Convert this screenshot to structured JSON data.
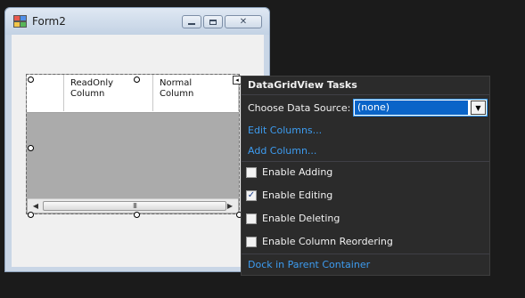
{
  "form": {
    "title": "Form2"
  },
  "grid": {
    "columns": [
      {
        "line1": "ReadOnly",
        "line2": "Column"
      },
      {
        "line1": "Normal",
        "line2": "Column"
      }
    ],
    "scroll_grip": "III"
  },
  "tasks_panel": {
    "title": "DataGridView Tasks",
    "data_source_label": "Choose Data Source:",
    "data_source_value": "(none)",
    "links": {
      "edit_columns": "Edit Columns...",
      "add_column": "Add Column...",
      "dock": "Dock in Parent Container"
    },
    "checks": [
      {
        "label": "Enable Adding",
        "checked": false
      },
      {
        "label": "Enable Editing",
        "checked": true
      },
      {
        "label": "Enable Deleting",
        "checked": false
      },
      {
        "label": "Enable Column Reordering",
        "checked": false
      }
    ]
  },
  "colors": {
    "link": "#3d9cf0",
    "panel_bg": "#2b2b2b",
    "selection": "#0a64c8"
  }
}
